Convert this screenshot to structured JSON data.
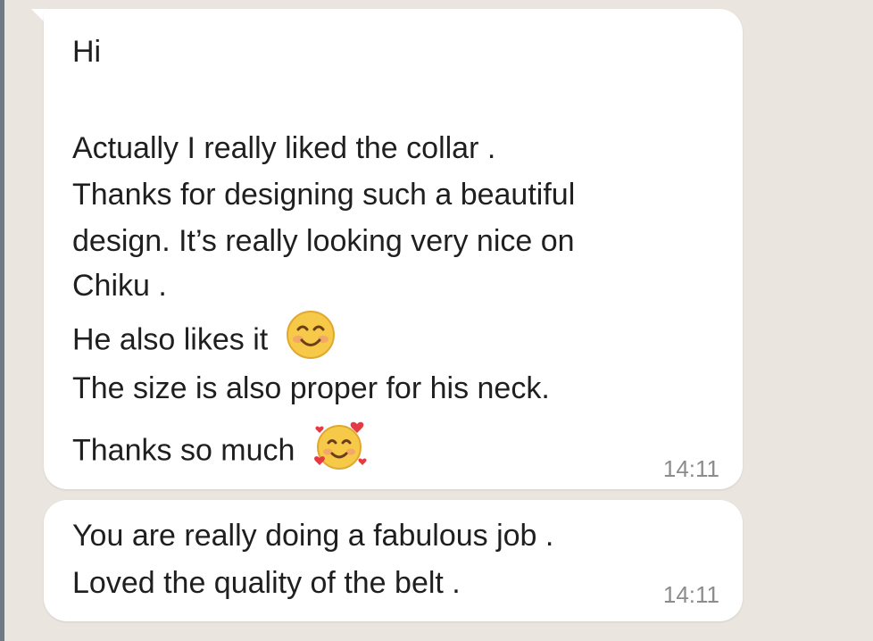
{
  "messages": [
    {
      "lines": [
        "Hi",
        "Actually I really liked the collar .",
        "Thanks for designing such a beautiful",
        "design. It’s really looking very nice on",
        "Chiku .",
        "He also likes it",
        "The size is also proper for his neck.",
        "Thanks so much"
      ],
      "emojis": [
        "smiling-face-icon",
        "smiling-face-with-hearts-icon"
      ],
      "time": "14:11"
    },
    {
      "lines": [
        "You are really doing a fabulous job .",
        "Loved the quality of the belt ."
      ],
      "time": "14:11"
    }
  ],
  "colors": {
    "background": "#ebe5df",
    "bubble": "#ffffff",
    "text": "#1f1f1f",
    "timestamp": "#8c8c8c"
  }
}
